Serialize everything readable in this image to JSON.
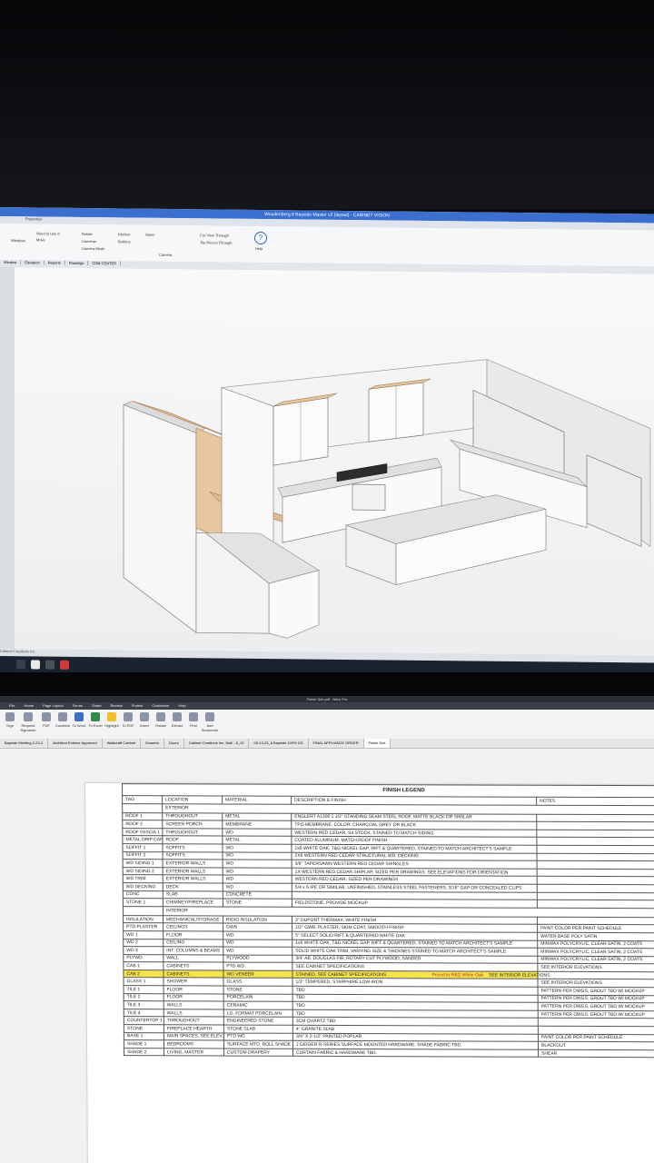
{
  "cv": {
    "title": "Woudenberg 6 Bayside Master v2 (layout) - CABINET VISION",
    "menu_tabs": [
      "",
      "Properties"
    ],
    "ribbon": {
      "items": [
        "Need to Use It",
        "Move",
        "Rotate",
        "Windows",
        "Cameras",
        "Camera Mode",
        "Kitchen",
        "Buttons",
        "Glass",
        "Cut View Through",
        "Top Pieces Through",
        "Camera"
      ],
      "help_label": "Help"
    },
    "view_tabs": [
      "Window",
      "Elevation",
      "Reports",
      "Drawings",
      "CDM CENTER"
    ],
    "status_text": "Cabinet Creations Inc."
  },
  "pdf": {
    "title": "Finish Sch.pdf - Nitro Pro",
    "menu": [
      "File",
      "Home",
      "Page Layout",
      "Forms",
      "Share",
      "Review",
      "Protect",
      "Customize",
      "Help"
    ],
    "tools": [
      "Sign",
      "Request Signature",
      "PDF",
      "Combine",
      "To Word",
      "To Excel",
      "Highlight",
      "To PDF",
      "Insert",
      "Rotate",
      "Extract",
      "Find",
      "Add Bookmark"
    ],
    "doc_tabs": [
      "Bayside Meeting 2-22-2",
      "Architect Exterior Approved",
      "Walkcraft Cabinet",
      "Drawers",
      "Doors",
      "Cabinet Creations Inc. Wall - 6_10",
      "09-13-23_6 Bayside 100% CD",
      "FINAL APPLIANCE ORDER",
      "Finish Sch"
    ]
  },
  "legend": {
    "title": "FINISH LEGEND",
    "headers": [
      "TAG",
      "LOCATION",
      "MATERIAL",
      "DESCRIPTION & FINISH",
      "NOTES"
    ],
    "exterior_label": "EXTERIOR",
    "exterior": [
      {
        "tag": "ROOF 1",
        "location": "THROUGHOUT",
        "material": "METAL",
        "desc": "ENGLERT A1300 1 1/2\" STANDING SEAM STEEL ROOF, MATTE BLACK OR SIMILAR",
        "notes": ""
      },
      {
        "tag": "ROOF 2",
        "location": "SCREEN PORCH",
        "material": "MEMBRANE",
        "desc": "TPO MEMBRANE. COLOR: CHARCOAL GREY OR BLACK",
        "notes": ""
      },
      {
        "tag": "ROOF FASCIA 1",
        "location": "THROUGHOUT",
        "material": "WD",
        "desc": "WESTERN RED CEDAR, S4 STOCK, STAINED TO MATCH SIDING",
        "notes": ""
      },
      {
        "tag": "METAL DRIP CAP",
        "location": "ROOF",
        "material": "METAL",
        "desc": "COATED ALUMINUM, MATCH ROOF FINISH",
        "notes": ""
      },
      {
        "tag": "SOFFIT 1",
        "location": "SOFFITS",
        "material": "WD",
        "desc": "1x6 WHITE OAK, T&G NICKEL GAP, RIFT & QUARTERED, STAINED TO MATCH ARCHITECT'S SAMPLE",
        "notes": ""
      },
      {
        "tag": "SOFFIT 2",
        "location": "SOFFITS",
        "material": "WD",
        "desc": "2X6 WESTERN RED CEDAR STRUCTURAL WD. DECKING",
        "notes": ""
      },
      {
        "tag": "WD SIDING 1",
        "location": "EXTERIOR WALLS",
        "material": "WD",
        "desc": "3/8\" TAPERSAWN WESTERN RED CEDAR SHINGLES",
        "notes": ""
      },
      {
        "tag": "WD SIDING 2",
        "location": "EXTERIOR WALLS",
        "material": "WD",
        "desc": "1X WESTERN RED CEDAR SHIPLAP, SIZED PER DRAWINGS. SEE ELEVATIONS FOR ORIENTATION",
        "notes": ""
      },
      {
        "tag": "WD TRIM",
        "location": "EXTERIOR WALLS",
        "material": "WD",
        "desc": "WESTERN RED CEDAR, SIZED PER DRAWINGS",
        "notes": ""
      },
      {
        "tag": "WD DECKING",
        "location": "DECK",
        "material": "WD",
        "desc": "5/4 x 6 IPE OR SIMILAR, UNFINISHED, STAINLESS STEEL FASTENERS, 3/16\" GAP OR CONCEALED CLIPS",
        "notes": ""
      },
      {
        "tag": "CONC",
        "location": "SLAB",
        "material": "CONCRETE",
        "desc": "",
        "notes": ""
      },
      {
        "tag": "STONE 1",
        "location": "CHIMNEY/FIREPLACE",
        "material": "STONE",
        "desc": "FIELDSTONE, PROVIDE MOCKUP",
        "notes": ""
      }
    ],
    "interior_label": "INTERIOR",
    "interior": [
      {
        "tag": "INSULATION",
        "location": "MECHANICAL/STORAGE",
        "material": "RIGID INSULATION",
        "desc": "3\" DUPONT THERMAX, WHITE FINISH",
        "notes": ""
      },
      {
        "tag": "PTD PLASTER",
        "location": "CEILINGS",
        "material": "GWB",
        "desc": "1/2\" GWB, PLASTER, SKIM COAT, SMOOTH FINISH",
        "notes": "PAINT COLOR PER PAINT SCHEDULE"
      },
      {
        "tag": "WD 1",
        "location": "FLOOR",
        "material": "WD",
        "desc": "5\" SELECT SOLID RIFT & QUARTERED WHITE OAK",
        "notes": "WATER BASE POLY SATIN"
      },
      {
        "tag": "WD 2",
        "location": "CEILING",
        "material": "WD",
        "desc": "1x6 WHITE OAK, T&G NICKEL GAP, RIFT & QUARTERED, STAINED TO MATCH ARCHITECT'S SAMPLE",
        "notes": "MINWAX POLYCRYLIC, CLEAR SATIN, 2 COATS"
      },
      {
        "tag": "WD 3",
        "location": "INT. COLUMNS & BEAMS",
        "material": "WD",
        "desc": "SOLID WHITE OAK TRIM, VARYING SIZE & THICKNES STAINED TO MATCH ARCHITECT'S SAMPLE",
        "notes": "MINWAX POLYCRYLIC, CLEAR SATIN, 2 COATS"
      },
      {
        "tag": "PLYWD",
        "location": "WALL",
        "material": "PLYWOOD",
        "desc": "3/4\" AB, DOUGLAS FIR, ROTARY CUT PLYWOOD, SANDED",
        "notes": "MINWAX POLYCRYLIC, CLEAR SATIN, 2 COATS"
      },
      {
        "tag": "CAB 1",
        "location": "CABINETS",
        "material": "PTD WD",
        "desc": "SEE CABINET SPECIFICATIONS",
        "notes": "SEE INTERIOR ELEVATIONS"
      },
      {
        "tag": "CAB 2",
        "location": "CABINETS",
        "material": "WD VENEER",
        "desc": "STAINED, SEE CABINET SPECIFICATIONS",
        "notes": "SEE INTERIOR ELEVATIONS",
        "highlight": true,
        "annotation": "Priced In R&Q White Oak"
      },
      {
        "tag": "GLASS 1",
        "location": "SHOWER",
        "material": "GLASS",
        "desc": "1/2\" TEMPERED, STARPHIRE LOW-IRON",
        "notes": "SEE INTERIOR ELEVATIONS"
      },
      {
        "tag": "TILE 1",
        "location": "FLOOR",
        "material": "STONE",
        "desc": "TBD",
        "notes": "PATTERN PER DWGS, GROUT TBD W/ MOCKUP"
      },
      {
        "tag": "TILE 2",
        "location": "FLOOR",
        "material": "PORCELAIN",
        "desc": "TBD",
        "notes": "PATTERN PER DWGS, GROUT TBD W/ MOCKUP"
      },
      {
        "tag": "TILE 3",
        "location": "WALLS",
        "material": "CERAMIC",
        "desc": "TBD",
        "notes": "PATTERN PER DWGS, GROUT TBD W/ MOCKUP"
      },
      {
        "tag": "TILE 4",
        "location": "WALLS",
        "material": "LG. FORMAT PORCELAIN",
        "desc": "TBD",
        "notes": "PATTERN PER DWGS, GROUT TBD W/ MOCKUP"
      },
      {
        "tag": "COUNTERTOP 1",
        "location": "THROUGHOUT",
        "material": "ENGINEERED STONE",
        "desc": "3CM QUARTZ TBD",
        "notes": ""
      },
      {
        "tag": "STONE",
        "location": "FIREPLACE HEARTH",
        "material": "STONE SLAB",
        "desc": "4\" GRANITE SLAB",
        "notes": ""
      },
      {
        "tag": "BASE 1",
        "location": "MAIN SPACES, SEE ELEV.",
        "material": "PTD WD",
        "desc": "3/4\" X 2-1/2\" PAINTED POPLAR",
        "notes": "PAINT COLOR PER PAINT SCHEDULE"
      },
      {
        "tag": "SHADE 1",
        "location": "BEDROOMS",
        "material": "SURFACE MTD. ROLL SHADE",
        "desc": "J GEIGER R-SERIES SURFACE MOUNTED HARDWARE. SHADE FABRIC TBD.",
        "notes": "BLACKOUT"
      },
      {
        "tag": "SHADE 2",
        "location": "LIVING, MASTER",
        "material": "CUSTOM DRAPERY",
        "desc": "CURTAIN FABRIC & HARDWARE TBD.",
        "notes": "SHEAR"
      }
    ]
  },
  "colors": {
    "highlight": "#f5e54a",
    "annotation": "#c41f1f",
    "titlebar": "#3a6fd0"
  }
}
